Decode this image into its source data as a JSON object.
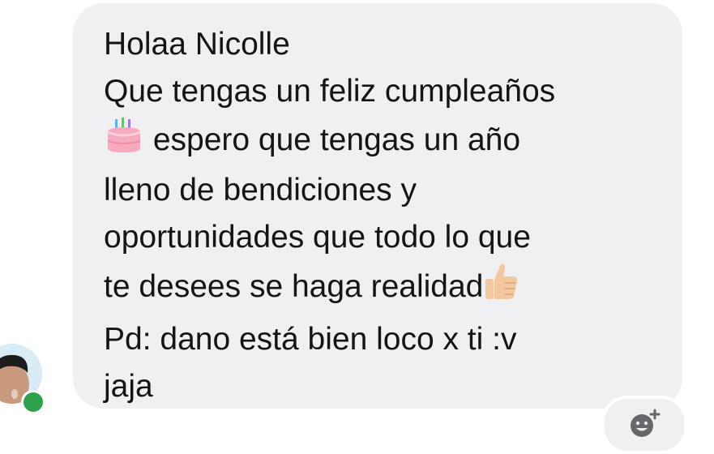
{
  "message": {
    "lines": [
      "Holaa Nicolle",
      "Que tengas un feliz cumpleaños",
      "espero que tengas un año",
      "lleno de bendiciones y",
      "oportunidades que todo lo que",
      "te desees se haga realidad",
      "Pd: dano está bien loco x ti :v",
      "jaja"
    ],
    "inline_icons": [
      "birthday-cake-icon",
      "thumbs-up-icon"
    ]
  },
  "sender": {
    "avatar_icon": "avatar-photo",
    "online": true
  },
  "reaction_button": {
    "icon": "add-reaction-icon"
  },
  "colors": {
    "bubble": "#f0f0f2",
    "text": "#141414",
    "online_dot": "#31a24c",
    "icon": "#65676b"
  }
}
